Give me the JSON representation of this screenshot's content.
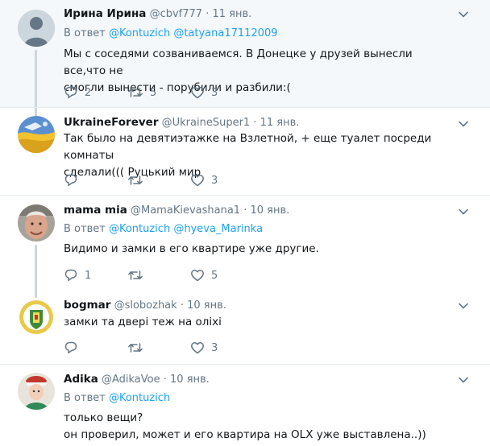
{
  "tweets": [
    {
      "name": "Ирина Ирина",
      "handle": "@cbvf777",
      "time": "11 янв.",
      "reply_prefix": "В ответ",
      "mentions": [
        "@Kontuzich",
        "@tatyana17112009"
      ],
      "text_lines": [
        "Мы с соседями созваниваемся. В Донецке у друзей вынесли все,что не",
        "смогли вынести - порубили и разбили:("
      ],
      "reply_count": "2",
      "retweet_count": "5",
      "like_count": "3"
    },
    {
      "name": "UkraineForever",
      "handle": "@UkraineSuper1",
      "time": "11 янв.",
      "text_lines": [
        "Так было на девятиэтажке на Взлетной, + еще туалет посреди комнаты",
        "сделали((( Руцький мир"
      ],
      "reply_count": "",
      "retweet_count": "",
      "like_count": "3"
    },
    {
      "name": "mama mia",
      "handle": "@MamaKievashana1",
      "time": "10 янв.",
      "reply_prefix": "В ответ",
      "mentions": [
        "@Kontuzich",
        "@hyeva_Marinka"
      ],
      "text_lines": [
        "Видимо и замки в его квартире уже другие."
      ],
      "reply_count": "1",
      "retweet_count": "",
      "like_count": "5"
    },
    {
      "name": "bogmar",
      "handle": "@slobozhak",
      "time": "10 янв.",
      "text_lines": [
        "замки та двері теж на оліхі"
      ],
      "reply_count": "",
      "retweet_count": "",
      "like_count": "3"
    },
    {
      "name": "Adika",
      "handle": "@AdikaVoe",
      "time": "10 янв.",
      "reply_prefix": "В ответ",
      "mentions": [
        "@Kontuzich"
      ],
      "text_lines": [
        "только вещи?",
        "он проверил, может и его квартира на OLX уже выставлена..))"
      ]
    }
  ],
  "separator": "·",
  "colors": {
    "text": "#14171a",
    "secondary": "#657786",
    "link": "#1da1f2",
    "thread_line": "#ccd6dd",
    "highlight_bg": "#f5f8fa"
  }
}
